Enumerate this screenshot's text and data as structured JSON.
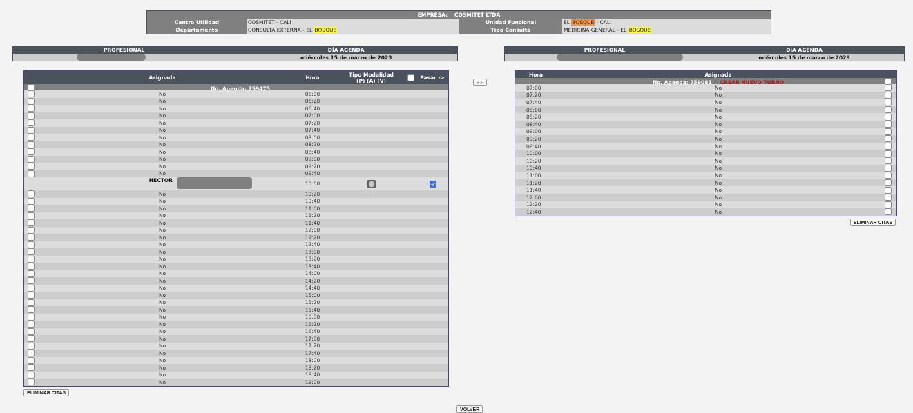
{
  "company": {
    "label": "EMPRESA:",
    "value": "COSMITET LTDA"
  },
  "info": [
    {
      "label": "Centro Utilidad",
      "parts": [
        {
          "text": "COSMITET - CALI"
        }
      ]
    },
    {
      "label": "Unidad Funcional",
      "parts": [
        {
          "text": "EL "
        },
        {
          "text": "BOSQUE",
          "color": "#f4913c"
        },
        {
          "text": " - CALI"
        }
      ]
    },
    {
      "label": "Departamento",
      "parts": [
        {
          "text": "CONSULTA EXTERNA - EL "
        },
        {
          "text": "BOSQUE",
          "color": "#ffff33"
        }
      ]
    },
    {
      "label": "Tipo Consulta",
      "parts": [
        {
          "text": "MEDICINA GENERAL - EL "
        },
        {
          "text": "BOSQUE",
          "color": "#ffff33"
        }
      ]
    }
  ],
  "left_panel": {
    "professional_header": "PROFESIONAL",
    "day_header": "DÍA AGENDA",
    "day": "miércoles 15 de marzo de 2023"
  },
  "right_panel": {
    "professional_header": "PROFESIONAL",
    "day_header": "DíA AGENDA",
    "day": "miércoles 15 de marzo de 2023"
  },
  "left_table": {
    "columns": {
      "asignada": "Asignada",
      "hora": "Hora",
      "tipo": "Tipo Modalidad",
      "tipo_sub": "(P) (A) (V)",
      "pasar": "Pasar ->"
    },
    "pasar_all_checked": false,
    "select_all_checked": false,
    "agenda": "No. Agenda: 759475",
    "rows": [
      {
        "kind": "free",
        "asignada": "No",
        "hora": "06:00",
        "checked": false
      },
      {
        "kind": "free",
        "asignada": "No",
        "hora": "06:20",
        "checked": false
      },
      {
        "kind": "free",
        "asignada": "No",
        "hora": "06:40",
        "checked": false
      },
      {
        "kind": "free",
        "asignada": "No",
        "hora": "07:00",
        "checked": false
      },
      {
        "kind": "free",
        "asignada": "No",
        "hora": "07:20",
        "checked": false
      },
      {
        "kind": "free",
        "asignada": "No",
        "hora": "07:40",
        "checked": false
      },
      {
        "kind": "free",
        "asignada": "No",
        "hora": "08:00",
        "checked": false
      },
      {
        "kind": "free",
        "asignada": "No",
        "hora": "08:20",
        "checked": false
      },
      {
        "kind": "free",
        "asignada": "No",
        "hora": "08:40",
        "checked": false
      },
      {
        "kind": "free",
        "asignada": "No",
        "hora": "09:00",
        "checked": false
      },
      {
        "kind": "free",
        "asignada": "No",
        "hora": "09:20",
        "checked": false
      },
      {
        "kind": "free",
        "asignada": "No",
        "hora": "09:40",
        "checked": false
      },
      {
        "kind": "assigned",
        "patient": "HECTOR",
        "hora": "10:00",
        "pasar": true
      },
      {
        "kind": "free",
        "asignada": "No",
        "hora": "10:20",
        "checked": false
      },
      {
        "kind": "free",
        "asignada": "No",
        "hora": "10:40",
        "checked": false
      },
      {
        "kind": "free",
        "asignada": "No",
        "hora": "11:00",
        "checked": false
      },
      {
        "kind": "free",
        "asignada": "No",
        "hora": "11:20",
        "checked": false
      },
      {
        "kind": "free",
        "asignada": "No",
        "hora": "11:40",
        "checked": false
      },
      {
        "kind": "free",
        "asignada": "No",
        "hora": "12:00",
        "checked": false
      },
      {
        "kind": "free",
        "asignada": "No",
        "hora": "12:20",
        "checked": false
      },
      {
        "kind": "free",
        "asignada": "No",
        "hora": "12:40",
        "checked": false
      },
      {
        "kind": "free",
        "asignada": "No",
        "hora": "13:00",
        "checked": false
      },
      {
        "kind": "free",
        "asignada": "No",
        "hora": "13:20",
        "checked": false
      },
      {
        "kind": "free",
        "asignada": "No",
        "hora": "13:40",
        "checked": false
      },
      {
        "kind": "free",
        "asignada": "No",
        "hora": "14:00",
        "checked": false
      },
      {
        "kind": "free",
        "asignada": "No",
        "hora": "14:20",
        "checked": false
      },
      {
        "kind": "free",
        "asignada": "No",
        "hora": "14:40",
        "checked": false
      },
      {
        "kind": "free",
        "asignada": "No",
        "hora": "15:00",
        "checked": false
      },
      {
        "kind": "free",
        "asignada": "No",
        "hora": "15:20",
        "checked": false
      },
      {
        "kind": "free",
        "asignada": "No",
        "hora": "15:40",
        "checked": false
      },
      {
        "kind": "free",
        "asignada": "No",
        "hora": "16:00",
        "checked": false
      },
      {
        "kind": "free",
        "asignada": "No",
        "hora": "16:20",
        "checked": false
      },
      {
        "kind": "free",
        "asignada": "No",
        "hora": "16:40",
        "checked": false
      },
      {
        "kind": "free",
        "asignada": "No",
        "hora": "17:00",
        "checked": false
      },
      {
        "kind": "free",
        "asignada": "No",
        "hora": "17:20",
        "checked": false
      },
      {
        "kind": "free",
        "asignada": "No",
        "hora": "17:40",
        "checked": false
      },
      {
        "kind": "free",
        "asignada": "No",
        "hora": "18:00",
        "checked": false
      },
      {
        "kind": "free",
        "asignada": "No",
        "hora": "18:20",
        "checked": false
      },
      {
        "kind": "free",
        "asignada": "No",
        "hora": "18:40",
        "checked": false
      },
      {
        "kind": "free",
        "asignada": "No",
        "hora": "19:00",
        "checked": false
      }
    ]
  },
  "move_button": ">>",
  "right_table": {
    "columns": {
      "hora": "Hora",
      "asignada": "Asignada"
    },
    "agenda": "No. Agenda: 759081",
    "create_link": "CREAR NUEVO TURNO",
    "select_all_checked": false,
    "rows": [
      {
        "hora": "07:00",
        "asignada": "No",
        "checked": false
      },
      {
        "hora": "07:20",
        "asignada": "No",
        "checked": false
      },
      {
        "hora": "07:40",
        "asignada": "No",
        "checked": false
      },
      {
        "hora": "08:00",
        "asignada": "No",
        "checked": false
      },
      {
        "hora": "08:20",
        "asignada": "No",
        "checked": false
      },
      {
        "hora": "08:40",
        "asignada": "No",
        "checked": false
      },
      {
        "hora": "09:00",
        "asignada": "No",
        "checked": false
      },
      {
        "hora": "09:20",
        "asignada": "No",
        "checked": false
      },
      {
        "hora": "09:40",
        "asignada": "No",
        "checked": false
      },
      {
        "hora": "10:00",
        "asignada": "No",
        "checked": false
      },
      {
        "hora": "10:20",
        "asignada": "No",
        "checked": false
      },
      {
        "hora": "10:40",
        "asignada": "No",
        "checked": false
      },
      {
        "hora": "11:00",
        "asignada": "No",
        "checked": false
      },
      {
        "hora": "11:20",
        "asignada": "No",
        "checked": false
      },
      {
        "hora": "11:40",
        "asignada": "No",
        "checked": false
      },
      {
        "hora": "12:00",
        "asignada": "No",
        "checked": false
      },
      {
        "hora": "12:20",
        "asignada": "No",
        "checked": false
      },
      {
        "hora": "12:40",
        "asignada": "No",
        "checked": false
      }
    ]
  },
  "left_delete_button": "ELIMINAR CITAS",
  "right_delete_button": "ELIMINAR CITAS",
  "back_button": "VOLVER"
}
